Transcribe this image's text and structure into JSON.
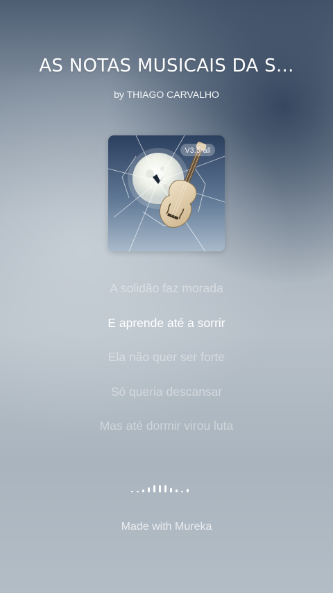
{
  "song": {
    "title": "AS NOTAS MUSICAIS DA S...",
    "artist_line": "by THIAGO CARVALHO"
  },
  "cover": {
    "badge": "V3.5-all",
    "icon": "moon-cello-shattered-glass-artwork"
  },
  "lyrics": [
    {
      "text": "A solidão faz morada",
      "active": false
    },
    {
      "text": "E aprende até a sorrir",
      "active": true
    },
    {
      "text": "Ela não quer ser forte",
      "active": false
    },
    {
      "text": "Só queria descansar",
      "active": false
    },
    {
      "text": "Mas até dormir virou luta",
      "active": false
    }
  ],
  "waveform": {
    "icon": "audio-waveform-icon",
    "levels": [
      0.2,
      0.2,
      0.35,
      0.55,
      0.8,
      0.8,
      0.8,
      0.5,
      0.3,
      0.2,
      0.45
    ]
  },
  "footer": {
    "text": "Made with Mureka"
  },
  "colors": {
    "active_lyric": "#ffffff",
    "inactive_lyric": "rgba(255,255,255,0.42)"
  }
}
